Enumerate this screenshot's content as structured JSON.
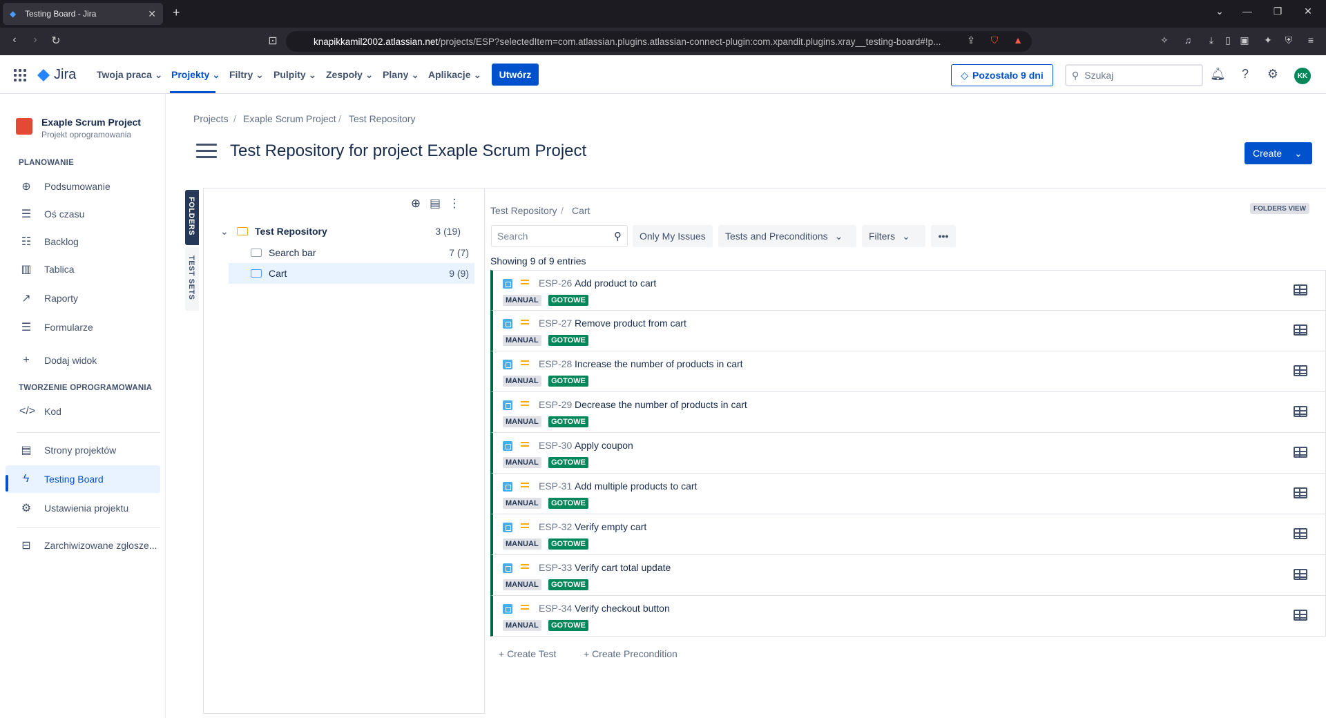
{
  "browser": {
    "tab_title": "Testing Board - Jira",
    "url_host": "knapikkamil2002.atlassian.net",
    "url_rest": "/projects/ESP?selectedItem=com.atlassian.plugins.atlassian-connect-plugin:com.xpandit.plugins.xray__testing-board#!p..."
  },
  "topnav": {
    "logo": "Jira",
    "menus": [
      "Twoja praca",
      "Projekty",
      "Filtry",
      "Pulpity",
      "Zespoły",
      "Plany",
      "Aplikacje"
    ],
    "create_label": "Utwórz",
    "trial_label": "Pozostało 9 dni",
    "search_placeholder": "Szukaj",
    "avatar": "KK"
  },
  "sidebar": {
    "project_name": "Exaple Scrum Project",
    "project_type": "Projekt oprogramowania",
    "section_planning": "PLANOWANIE",
    "planning_items": [
      "Podsumowanie",
      "Oś czasu",
      "Backlog",
      "Tablica",
      "Raporty",
      "Formularze",
      "Dodaj widok"
    ],
    "section_dev": "TWORZENIE OPROGRAMOWANIA",
    "dev_items": [
      "Kod"
    ],
    "other_items": [
      "Strony projektów",
      "Testing Board",
      "Ustawienia projektu"
    ],
    "archived": "Zarchiwizowane zgłosze..."
  },
  "breadcrumbs": [
    "Projects",
    "Exaple Scrum Project",
    "Test Repository"
  ],
  "page_title": "Test Repository for project Exaple Scrum Project",
  "create_button": "Create",
  "vtabs": {
    "folders": "FOLDERS",
    "test_sets": "TEST SETS"
  },
  "tree": [
    {
      "name": "Test Repository",
      "count": "3 (19)"
    },
    {
      "name": "Search bar",
      "count": "7 (7)"
    },
    {
      "name": "Cart",
      "count": "9 (9)"
    }
  ],
  "right": {
    "crumb_root": "Test Repository",
    "crumb_leaf": "Cart",
    "folders_view": "FOLDERS VIEW",
    "search_placeholder": "Search",
    "filter_only_mine": "Only My Issues",
    "filter_types": "Tests and Preconditions",
    "filter_filters": "Filters",
    "entries": "Showing 9 of 9 entries",
    "create_test": "+ Create Test",
    "create_precondition": "+ Create Precondition"
  },
  "issues": [
    {
      "key": "ESP-26",
      "summary": "Add product to cart",
      "type": "MANUAL",
      "status": "GOTOWE"
    },
    {
      "key": "ESP-27",
      "summary": "Remove product from cart",
      "type": "MANUAL",
      "status": "GOTOWE"
    },
    {
      "key": "ESP-28",
      "summary": "Increase the number of products in cart",
      "type": "MANUAL",
      "status": "GOTOWE"
    },
    {
      "key": "ESP-29",
      "summary": "Decrease the number of products in cart",
      "type": "MANUAL",
      "status": "GOTOWE"
    },
    {
      "key": "ESP-30",
      "summary": "Apply coupon",
      "type": "MANUAL",
      "status": "GOTOWE"
    },
    {
      "key": "ESP-31",
      "summary": "Add multiple products to cart",
      "type": "MANUAL",
      "status": "GOTOWE"
    },
    {
      "key": "ESP-32",
      "summary": "Verify empty cart",
      "type": "MANUAL",
      "status": "GOTOWE"
    },
    {
      "key": "ESP-33",
      "summary": "Verify cart total update",
      "type": "MANUAL",
      "status": "GOTOWE"
    },
    {
      "key": "ESP-34",
      "summary": "Verify checkout button",
      "type": "MANUAL",
      "status": "GOTOWE"
    }
  ]
}
